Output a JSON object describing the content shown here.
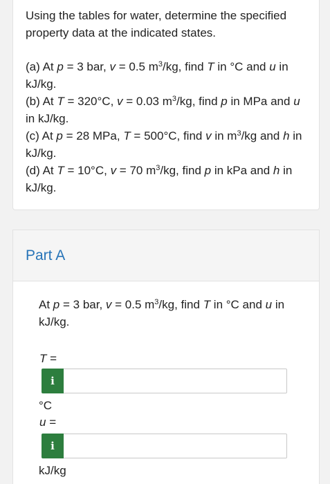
{
  "problem": {
    "intro": "Using the tables for water, determine the specified property data at the indicated states.",
    "parts": [
      {
        "label": "(a)",
        "text": "At p = 3 bar, v = 0.5 m³/kg, find T in °C and u in kJ/kg."
      },
      {
        "label": "(b)",
        "text": "At T = 320°C, v = 0.03 m³/kg, find p in MPa and u in kJ/kg."
      },
      {
        "label": "(c)",
        "text": "At p = 28 MPa, T = 500°C, find v in m³/kg and h in kJ/kg."
      },
      {
        "label": "(d)",
        "text": "At T = 10°C, v = 70 m³/kg, find p in kPa and h in kJ/kg."
      }
    ]
  },
  "part_a": {
    "title": "Part A",
    "question": "At p = 3 bar, v = 0.5 m³/kg, find T in °C and u in kJ/kg.",
    "answers": [
      {
        "variable": "T =",
        "info_icon": "i",
        "value": "",
        "unit": "°C"
      },
      {
        "variable": "u =",
        "info_icon": "i",
        "value": "",
        "unit": "kJ/kg"
      }
    ]
  },
  "colors": {
    "title_blue": "#2774b8",
    "info_green": "#2d7e3e"
  }
}
